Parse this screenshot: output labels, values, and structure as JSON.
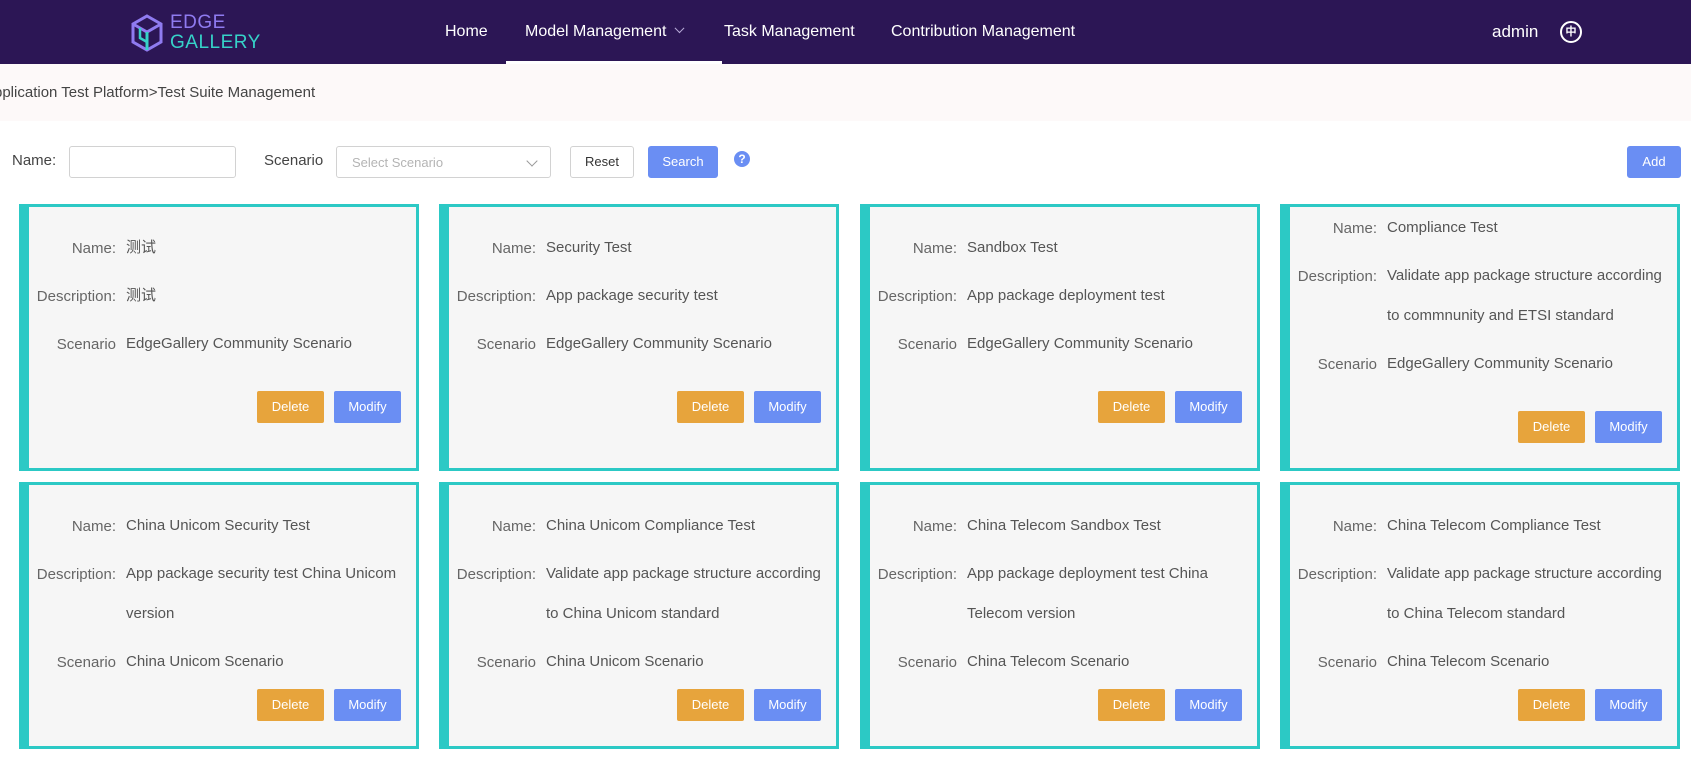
{
  "header": {
    "logo_line1": "EDGE",
    "logo_line2": "GALLERY",
    "nav": [
      {
        "label": "Home"
      },
      {
        "label": "Model Management"
      },
      {
        "label": "Task Management"
      },
      {
        "label": "Contribution Management"
      }
    ],
    "user": "admin",
    "lang_icon": "中"
  },
  "breadcrumb": "pplication Test Platform>Test Suite Management",
  "search": {
    "name_label": "Name:",
    "name_value": "",
    "scenario_label": "Scenario",
    "scenario_placeholder": "Select Scenario",
    "reset_label": "Reset",
    "search_label": "Search",
    "help_icon": "?",
    "add_label": "Add"
  },
  "labels": {
    "name": "Name:",
    "description": "Description:",
    "scenario": "Scenario",
    "delete": "Delete",
    "modify": "Modify"
  },
  "cards": [
    {
      "name": "测试",
      "description": "测试",
      "scenario": "EdgeGallery Community Scenario"
    },
    {
      "name": "Security Test",
      "description": "App package security test",
      "scenario": "EdgeGallery Community Scenario"
    },
    {
      "name": "Sandbox Test",
      "description": "App package deployment test",
      "scenario": "EdgeGallery Community Scenario"
    },
    {
      "name": "Compliance Test",
      "description": "Validate app package structure according to commnunity and ETSI standard",
      "scenario": "EdgeGallery Community Scenario"
    },
    {
      "name": "China Unicom Security Test",
      "description": "App package security test China Unicom version",
      "scenario": "China Unicom Scenario"
    },
    {
      "name": "China Unicom Compliance Test",
      "description": "Validate app package structure according to China Unicom standard",
      "scenario": "China Unicom Scenario"
    },
    {
      "name": "China Telecom Sandbox Test",
      "description": "App package deployment test China Telecom version",
      "scenario": "China Telecom Scenario"
    },
    {
      "name": "China Telecom Compliance Test",
      "description": "Validate app package structure according to China Telecom standard",
      "scenario": "China Telecom Scenario"
    }
  ],
  "colors": {
    "header_bg": "#2c1655",
    "accent": "#6a8ef3",
    "delete": "#e7a43c",
    "card_border": "#2cc9c5"
  }
}
